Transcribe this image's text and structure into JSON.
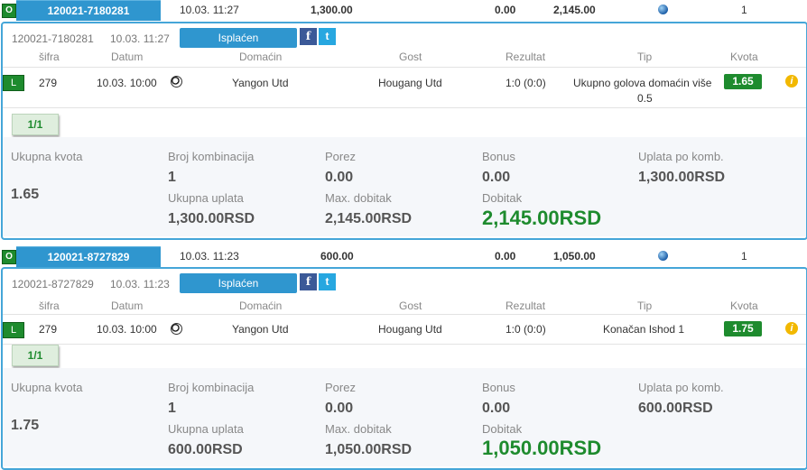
{
  "tickets": [
    {
      "summary": {
        "badge": "O",
        "ticket_id": "120021-7180281",
        "datetime": "10.03. 11:27",
        "stake": "1,300.00",
        "amount_zero": "0.00",
        "payout": "2,145.00",
        "count": "1"
      },
      "header": {
        "ticket_id": "120021-7180281",
        "datetime": "10.03. 11:27",
        "status": "Isplaćen",
        "facebook": "f",
        "twitter": "t"
      },
      "columns": {
        "code": "šifra",
        "date": "Datum",
        "home": "Domaćin",
        "away": "Gost",
        "result": "Rezultat",
        "tip": "Tip",
        "odds": "Kvota"
      },
      "event": {
        "badge": "L",
        "code": "279",
        "date": "10.03. 10:00",
        "home": "Yangon Utd",
        "away": "Hougang Utd",
        "result": "1:0 (0:0)",
        "tip_line1": "Ukupno golova domaćin više",
        "tip_line2": "0.5",
        "odds": "1.65"
      },
      "combo": "1/1",
      "footer": {
        "total_odds_label": "Ukupna kvota",
        "total_odds": "1.65",
        "combos_label": "Broj kombinacija",
        "combos": "1",
        "total_stake_label": "Ukupna uplata",
        "total_stake": "1,300.00RSD",
        "tax_label": "Porez",
        "tax": "0.00",
        "max_win_label": "Max. dobitak",
        "max_win": "2,145.00RSD",
        "bonus_label": "Bonus",
        "bonus": "0.00",
        "win_label": "Dobitak",
        "win": "2,145.00RSD",
        "per_combo_label": "Uplata po komb.",
        "per_combo": "1,300.00RSD"
      }
    },
    {
      "summary": {
        "badge": "O",
        "ticket_id": "120021-8727829",
        "datetime": "10.03. 11:23",
        "stake": "600.00",
        "amount_zero": "0.00",
        "payout": "1,050.00",
        "count": "1"
      },
      "header": {
        "ticket_id": "120021-8727829",
        "datetime": "10.03. 11:23",
        "status": "Isplaćen",
        "facebook": "f",
        "twitter": "t"
      },
      "columns": {
        "code": "šifra",
        "date": "Datum",
        "home": "Domaćin",
        "away": "Gost",
        "result": "Rezultat",
        "tip": "Tip",
        "odds": "Kvota"
      },
      "event": {
        "badge": "L",
        "code": "279",
        "date": "10.03. 10:00",
        "home": "Yangon Utd",
        "away": "Hougang Utd",
        "result": "1:0 (0:0)",
        "tip_line1": "Konačan Ishod 1",
        "tip_line2": "",
        "odds": "1.75"
      },
      "combo": "1/1",
      "footer": {
        "total_odds_label": "Ukupna kvota",
        "total_odds": "1.75",
        "combos_label": "Broj kombinacija",
        "combos": "1",
        "total_stake_label": "Ukupna uplata",
        "total_stake": "600.00RSD",
        "tax_label": "Porez",
        "tax": "0.00",
        "max_win_label": "Max. dobitak",
        "max_win": "1,050.00RSD",
        "bonus_label": "Bonus",
        "bonus": "0.00",
        "win_label": "Dobitak",
        "win": "1,050.00RSD",
        "per_combo_label": "Uplata po komb.",
        "per_combo": "600.00RSD"
      }
    }
  ],
  "icons": {
    "globe": "globe-icon",
    "ball": "soccer-ball-icon",
    "info": "info-icon"
  },
  "colors": {
    "accent_blue": "#2f96cf",
    "win_green": "#1e8b2e",
    "info_yellow": "#f2b800"
  }
}
